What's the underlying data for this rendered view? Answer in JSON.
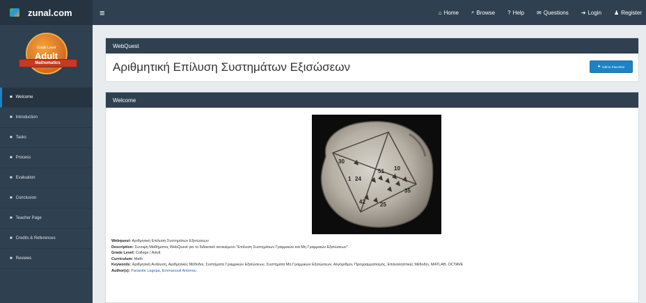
{
  "brand": {
    "name": "zunal.com"
  },
  "topnav": [
    {
      "icon": "home-icon",
      "glyph": "⌂",
      "label": "Home"
    },
    {
      "icon": "search-icon",
      "glyph": "⌕",
      "label": "Browse"
    },
    {
      "icon": "help-icon",
      "glyph": "?",
      "label": "Help"
    },
    {
      "icon": "comments-icon",
      "glyph": "✉",
      "label": "Questions"
    },
    {
      "icon": "login-icon",
      "glyph": "➜",
      "label": "Login"
    },
    {
      "icon": "register-icon",
      "glyph": "♟",
      "label": "Register"
    }
  ],
  "badge": {
    "top": "Grade Level",
    "main": "Adult",
    "ribbon": "Mathematics"
  },
  "sidebar": {
    "items": [
      {
        "label": "Welcome",
        "active": true
      },
      {
        "label": "Introduction"
      },
      {
        "label": "Tasks"
      },
      {
        "label": "Process"
      },
      {
        "label": "Evaluation"
      },
      {
        "label": "Conclusion"
      },
      {
        "label": "Teacher Page"
      },
      {
        "label": "Credits & References"
      },
      {
        "label": "Reviews"
      }
    ]
  },
  "panel1": {
    "header": "WebQuest",
    "title": "Αριθμητική Επίλυση Συστημάτων Εξισώσεων",
    "add_button": "Add to Favorites"
  },
  "panel2": {
    "header": "Welcome",
    "image_numbers": [
      "30",
      "1",
      "24",
      "51",
      "10",
      "42",
      "25",
      "35"
    ],
    "meta": {
      "webquest_label": "Webquest:",
      "webquest_value": "Αριθμητική Επίλυση Συστημάτων Εξισώσεων",
      "description_label": "Description:",
      "description_value": "Συνοψη Μαθήματος WebQuest για το διδακτικό αντικείμενο \"Επίλυση Συστημάτων Γραμμικών και Μη Γραμμικών Εξισώσεων\"",
      "grade_label": "Grade Level:",
      "grade_value": "College / Adult",
      "curriculum_label": "Curriculum:",
      "curriculum_value": "Math",
      "keywords_label": "Keywords:",
      "keywords_value": "Αριθμητική Ανάλυση, Αριθμητικές Μέθοδοι, Συστήματα Γραμμικών Εξισώσεων, Συστήματα Μη Γραμμικών Εξισώσεων, Αλγόριθμοι, Προγραμματισμός, Επαναληπτικές Μέθοδοι, MATLAB, OCTAVE",
      "authors_label": "Author(s):",
      "authors_value": "Panaoite Lagopa, Emmanouil Antonou"
    }
  },
  "colors": {
    "topbar": "#2f4050",
    "accent": "#1c84c6",
    "panel_head": "#2f4050"
  }
}
